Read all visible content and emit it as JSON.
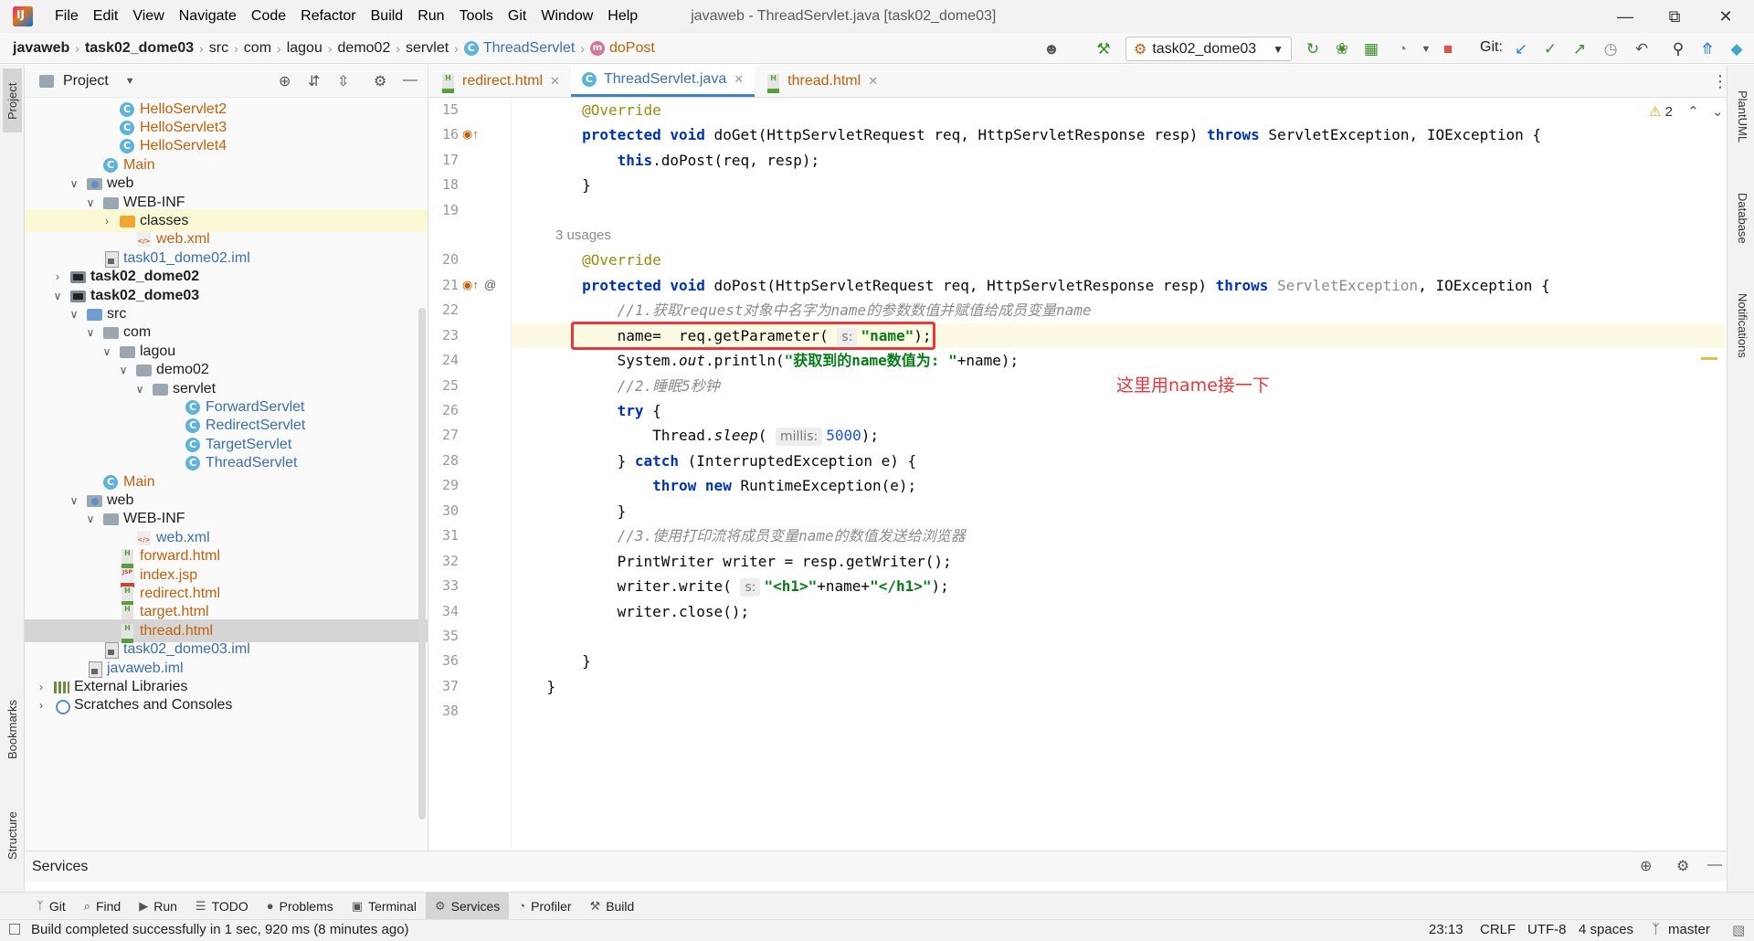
{
  "window": {
    "title": "javaweb - ThreadServlet.java [task02_dome03]",
    "menu": [
      "File",
      "Edit",
      "View",
      "Navigate",
      "Code",
      "Refactor",
      "Build",
      "Run",
      "Tools",
      "Git",
      "Window",
      "Help"
    ]
  },
  "breadcrumb": [
    "javaweb",
    "task02_dome03",
    "src",
    "com",
    "lagou",
    "demo02",
    "servlet",
    "ThreadServlet",
    "doPost"
  ],
  "toolbar": {
    "run_config": "task02_dome03",
    "git_label": "Git:"
  },
  "left_strip": {
    "project": "Project",
    "bookmarks": "Bookmarks",
    "structure": "Structure"
  },
  "right_strip": {
    "plantuml": "PlantUML",
    "database": "Database",
    "notifications": "Notifications"
  },
  "project_panel": {
    "title": "Project",
    "tree": [
      {
        "label": "HelloServlet2",
        "icon": "class",
        "indent": 4,
        "color": "orange"
      },
      {
        "label": "HelloServlet3",
        "icon": "class",
        "indent": 4,
        "color": "orange"
      },
      {
        "label": "HelloServlet4",
        "icon": "class",
        "indent": 4,
        "color": "orange"
      },
      {
        "label": "Main",
        "icon": "class",
        "indent": 3,
        "color": "orange"
      },
      {
        "label": "web",
        "icon": "folder-web",
        "indent": 2,
        "arrow": "open"
      },
      {
        "label": "WEB-INF",
        "icon": "folder",
        "indent": 3,
        "arrow": "open"
      },
      {
        "label": "classes",
        "icon": "folder-org",
        "indent": 4,
        "arrow": "closed",
        "hl": true
      },
      {
        "label": "web.xml",
        "icon": "xml",
        "indent": 5,
        "color": "orange"
      },
      {
        "label": "task01_dome02.iml",
        "icon": "iml",
        "indent": 3,
        "color": "blue"
      },
      {
        "label": "task02_dome02",
        "icon": "folder-mod",
        "indent": 1,
        "arrow": "closed",
        "bold": true
      },
      {
        "label": "task02_dome03",
        "icon": "folder-mod",
        "indent": 1,
        "arrow": "open",
        "bold": true
      },
      {
        "label": "src",
        "icon": "folder-src",
        "indent": 2,
        "arrow": "open"
      },
      {
        "label": "com",
        "icon": "folder",
        "indent": 3,
        "arrow": "open"
      },
      {
        "label": "lagou",
        "icon": "folder",
        "indent": 4,
        "arrow": "open"
      },
      {
        "label": "demo02",
        "icon": "folder",
        "indent": 5,
        "arrow": "open"
      },
      {
        "label": "servlet",
        "icon": "folder",
        "indent": 6,
        "arrow": "open"
      },
      {
        "label": "ForwardServlet",
        "icon": "class",
        "indent": 8,
        "color": "blue"
      },
      {
        "label": "RedirectServlet",
        "icon": "class",
        "indent": 8,
        "color": "blue"
      },
      {
        "label": "TargetServlet",
        "icon": "class",
        "indent": 8,
        "color": "blue"
      },
      {
        "label": "ThreadServlet",
        "icon": "class",
        "indent": 8,
        "color": "blue"
      },
      {
        "label": "Main",
        "icon": "class",
        "indent": 3,
        "color": "orange"
      },
      {
        "label": "web",
        "icon": "folder-web",
        "indent": 2,
        "arrow": "open"
      },
      {
        "label": "WEB-INF",
        "icon": "folder",
        "indent": 3,
        "arrow": "open"
      },
      {
        "label": "web.xml",
        "icon": "xml",
        "indent": 5,
        "color": "blue"
      },
      {
        "label": "forward.html",
        "icon": "html",
        "indent": 4,
        "color": "orange"
      },
      {
        "label": "index.jsp",
        "icon": "jsp",
        "indent": 4,
        "color": "orange"
      },
      {
        "label": "redirect.html",
        "icon": "html",
        "indent": 4,
        "color": "orange"
      },
      {
        "label": "target.html",
        "icon": "html",
        "indent": 4,
        "color": "orange"
      },
      {
        "label": "thread.html",
        "icon": "html",
        "indent": 4,
        "color": "orange",
        "sel": true
      },
      {
        "label": "task02_dome03.iml",
        "icon": "iml",
        "indent": 3,
        "color": "blue"
      },
      {
        "label": "javaweb.iml",
        "icon": "iml",
        "indent": 2,
        "color": "blue"
      },
      {
        "label": "External Libraries",
        "icon": "lib",
        "indent": 0,
        "arrow": "closed"
      },
      {
        "label": "Scratches and Consoles",
        "icon": "scratch",
        "indent": 0,
        "arrow": "closed"
      }
    ]
  },
  "tabs": [
    {
      "label": "redirect.html",
      "icon": "html"
    },
    {
      "label": "ThreadServlet.java",
      "icon": "class",
      "active": true
    },
    {
      "label": "thread.html",
      "icon": "html"
    }
  ],
  "editor": {
    "warning_count": "2",
    "usages": "3 usages",
    "annotation": "这里用name接一下",
    "lines": [
      {
        "n": "15",
        "html": "        <span class=\"ann\">@Override</span>"
      },
      {
        "n": "16",
        "html": "        <span class=\"kw\">protected void</span> doGet(HttpServletRequest req, HttpServletResponse resp) <span class=\"kw\">throws</span> ServletException, IOException {"
      },
      {
        "n": "17",
        "html": "            <span class=\"kw\">this</span>.doPost(req, resp);"
      },
      {
        "n": "18",
        "html": "        }"
      },
      {
        "n": "19",
        "html": ""
      },
      {
        "n": "20",
        "html": "        <span class=\"ann\">@Override</span>"
      },
      {
        "n": "21",
        "html": "        <span class=\"kw\">protected void</span> doPost(HttpServletRequest req, HttpServletResponse resp) <span class=\"kw\">throws</span> <span class=\"gray\">ServletException</span>, IOException {"
      },
      {
        "n": "22",
        "html": "            <span class=\"cmt\">//1.获取request对象中名字为name的参数数值并赋值给成员变量name</span>"
      },
      {
        "n": "23",
        "html": "            name=  req.getParameter( <span class=\"hint\">s:</span><span class=\"str\">\"name\"</span>);",
        "cur": true
      },
      {
        "n": "24",
        "html": "            System.<span class=\"it\">out</span>.println(<span class=\"str\">\"获取到的name数值为: \"</span>+name);"
      },
      {
        "n": "25",
        "html": "            <span class=\"cmt\">//2.睡眠5秒钟</span>"
      },
      {
        "n": "26",
        "html": "            <span class=\"kw\">try</span> {"
      },
      {
        "n": "27",
        "html": "                Thread.<span class=\"it\">sleep</span>( <span class=\"hint\">millis:</span><span class=\"num\">5000</span>);"
      },
      {
        "n": "28",
        "html": "            } <span class=\"kw\">catch</span> (InterruptedException e) {"
      },
      {
        "n": "29",
        "html": "                <span class=\"kw\">throw new</span> RuntimeException(e);"
      },
      {
        "n": "30",
        "html": "            }"
      },
      {
        "n": "31",
        "html": "            <span class=\"cmt\">//3.使用打印流将成员变量name的数值发送给浏览器</span>"
      },
      {
        "n": "32",
        "html": "            PrintWriter writer = resp.getWriter();"
      },
      {
        "n": "33",
        "html": "            writer.write( <span class=\"hint\">s:</span><span class=\"str\">\"&lt;h1&gt;\"</span>+name+<span class=\"str\">\"&lt;/h1&gt;\"</span>);"
      },
      {
        "n": "34",
        "html": "            writer.close();"
      },
      {
        "n": "35",
        "html": ""
      },
      {
        "n": "36",
        "html": "        }"
      },
      {
        "n": "37",
        "html": "    }"
      },
      {
        "n": "38",
        "html": ""
      }
    ]
  },
  "services_bar": {
    "title": "Services"
  },
  "bottom_tools": [
    {
      "label": "Git",
      "icon": "git-icon"
    },
    {
      "label": "Find",
      "icon": "search-icon"
    },
    {
      "label": "Run",
      "icon": "run-icon"
    },
    {
      "label": "TODO",
      "icon": "todo-icon"
    },
    {
      "label": "Problems",
      "icon": "problems-icon"
    },
    {
      "label": "Terminal",
      "icon": "terminal-icon"
    },
    {
      "label": "Services",
      "icon": "services-icon",
      "active": true
    },
    {
      "label": "Profiler",
      "icon": "profiler-icon"
    },
    {
      "label": "Build",
      "icon": "build-icon"
    }
  ],
  "status": {
    "message": "Build completed successfully in 1 sec, 920 ms (8 minutes ago)",
    "position": "23:13",
    "line_sep": "CRLF",
    "encoding": "UTF-8",
    "indent": "4 spaces",
    "branch": "master"
  }
}
